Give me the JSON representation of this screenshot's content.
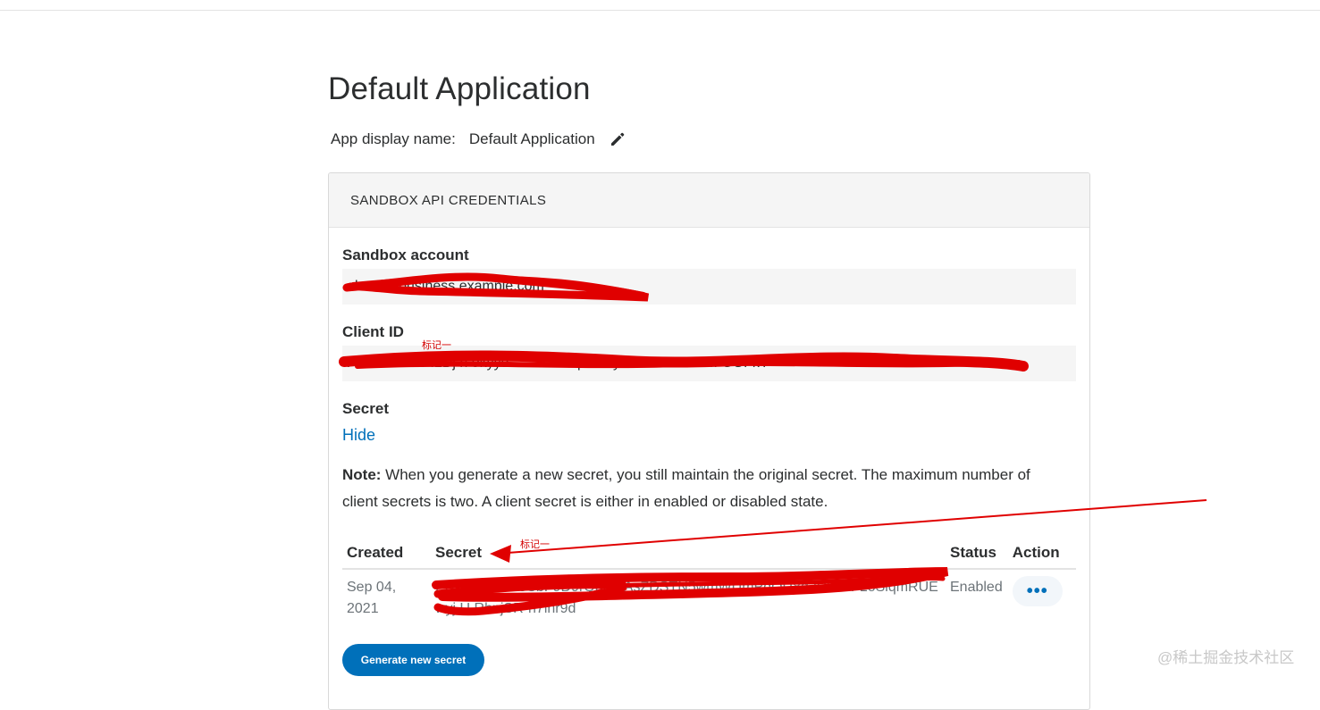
{
  "page": {
    "title": "Default Application",
    "display_name_label": "App display name:",
    "display_name_value": "Default Application"
  },
  "card": {
    "header": "SANDBOX API CREDENTIALS",
    "sandbox_account_label": "Sandbox account",
    "sandbox_account_value": "sb-r     f          @business.example.com",
    "client_id_label": "Client ID",
    "client_id_value": "AbKSO   tGzr  f1Dj  h       9kyyd      -  ... 0 9 ...  p    ...  dy  AWYz  ...  iEHM  GGFkY",
    "secret_label": "Secret",
    "hide_link": "Hide",
    "note_bold": "Note:",
    "note_text": " When you generate a new secret, you still maintain the original secret. The maximum number of client secrets is two. A client secret is either in enabled or disabled state.",
    "table": {
      "headers": [
        "Created",
        "Secret",
        "Status",
        "Action"
      ],
      "rows": [
        {
          "created": "Sep 04, 2021",
          "secret": "EBybtE5YbU5SbF9D9rQur62AsZDSTN5wmWUmPdQU8d3DxaTFLoSiqmRUE wyj  U  RbnjSR-n7ihr9d",
          "status": "Enabled",
          "action": "•••"
        }
      ]
    },
    "generate_button": "Generate new secret"
  },
  "annotations": {
    "mark1": "标记一",
    "mark2": "标记一"
  },
  "watermark": "@稀土掘金技术社区",
  "colors": {
    "link": "#0070ba",
    "button": "#0070ba",
    "header_bg": "#f5f5f5",
    "redaction": "#e00000"
  },
  "icons": {
    "edit": "pencil-icon",
    "action": "more-dots-icon"
  }
}
